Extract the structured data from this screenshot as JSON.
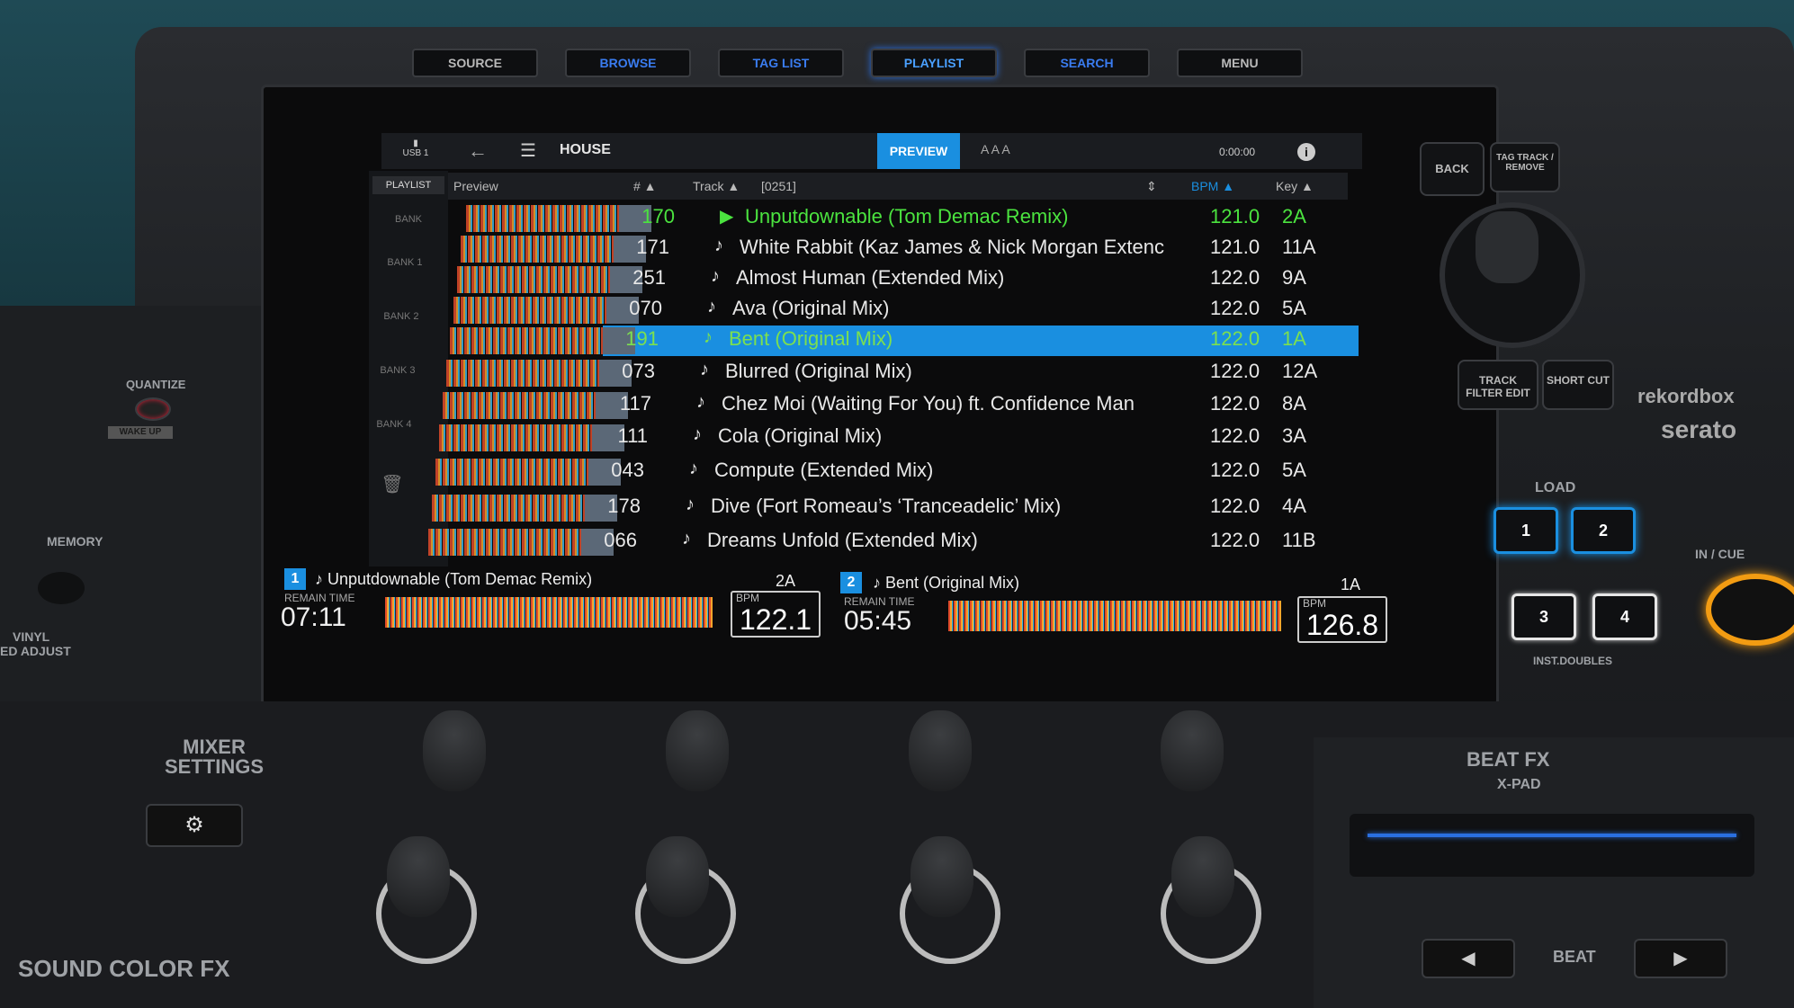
{
  "hardware_buttons": [
    "SOURCE",
    "BROWSE",
    "TAG LIST",
    "PLAYLIST",
    "SEARCH",
    "MENU"
  ],
  "browser": {
    "source": "USB 1",
    "folder": "HOUSE",
    "preview_label": "PREVIEW",
    "font_sizes": "A A A",
    "time": "0:00:00",
    "columns": {
      "preview": "Preview",
      "num": "#",
      "track": "Track",
      "count": "[0251]",
      "bpm": "BPM",
      "key": "Key"
    },
    "sidebar": [
      "PLAYLIST",
      "BANK",
      "BANK 1",
      "BANK 2",
      "BANK 3",
      "BANK 4"
    ],
    "tracks": [
      {
        "num": "170",
        "title": "Unputdownable (Tom Demac Remix)",
        "bpm": "121.0",
        "key": "2A",
        "state": "playing"
      },
      {
        "num": "171",
        "title": "White Rabbit (Kaz James & Nick Morgan Extenc",
        "bpm": "121.0",
        "key": "11A",
        "state": ""
      },
      {
        "num": "251",
        "title": "Almost Human (Extended Mix)",
        "bpm": "122.0",
        "key": "9A",
        "state": ""
      },
      {
        "num": "070",
        "title": "Ava (Original Mix)",
        "bpm": "122.0",
        "key": "5A",
        "state": ""
      },
      {
        "num": "191",
        "title": "Bent (Original Mix)",
        "bpm": "122.0",
        "key": "1A",
        "state": "selected"
      },
      {
        "num": "073",
        "title": "Blurred (Original Mix)",
        "bpm": "122.0",
        "key": "12A",
        "state": ""
      },
      {
        "num": "117",
        "title": "Chez Moi (Waiting For You) ft. Confidence Man",
        "bpm": "122.0",
        "key": "8A",
        "state": ""
      },
      {
        "num": "111",
        "title": "Cola (Original Mix)",
        "bpm": "122.0",
        "key": "3A",
        "state": ""
      },
      {
        "num": "043",
        "title": "Compute (Extended Mix)",
        "bpm": "122.0",
        "key": "5A",
        "state": ""
      },
      {
        "num": "178",
        "title": "Dive (Fort Romeau’s ‘Tranceadelic’ Mix)",
        "bpm": "122.0",
        "key": "4A",
        "state": ""
      },
      {
        "num": "066",
        "title": "Dreams Unfold (Extended Mix)",
        "bpm": "122.0",
        "key": "11B",
        "state": ""
      }
    ],
    "note_symbol": "♪",
    "play_symbol": "▶"
  },
  "decks": [
    {
      "num": "1",
      "title": "Unputdownable (Tom Demac Remix)",
      "key": "2A",
      "remain_label": "REMAIN TIME",
      "time": "07:11",
      "bpm_label": "BPM",
      "bpm": "122.1"
    },
    {
      "num": "2",
      "title": "Bent (Original Mix)",
      "key": "1A",
      "remain_label": "REMAIN TIME",
      "time": "05:45",
      "bpm_label": "BPM",
      "bpm": "126.8"
    }
  ],
  "right_controls": {
    "back": "BACK",
    "tag_track": "TAG TRACK / REMOVE",
    "track_filter": "TRACK FILTER EDIT",
    "short_cut": "SHORT CUT",
    "load": "LOAD",
    "load_buttons": [
      "1",
      "2",
      "3",
      "4"
    ],
    "inst_doubles": "INST.DOUBLES",
    "in_cue": "IN / CUE",
    "brand1": "rekordbox",
    "brand2": "serato"
  },
  "left_controls": {
    "quantize": "QUANTIZE",
    "wake_up": "WAKE UP",
    "memory": "MEMORY",
    "vinyl": "VINYL",
    "ed_adjust": "ED ADJUST"
  },
  "mixer": {
    "settings": "MIXER SETTINGS",
    "sound_color_fx": "SOUND COLOR FX",
    "beat_fx": "BEAT FX",
    "x_pad": "X-PAD",
    "beat": "BEAT"
  }
}
